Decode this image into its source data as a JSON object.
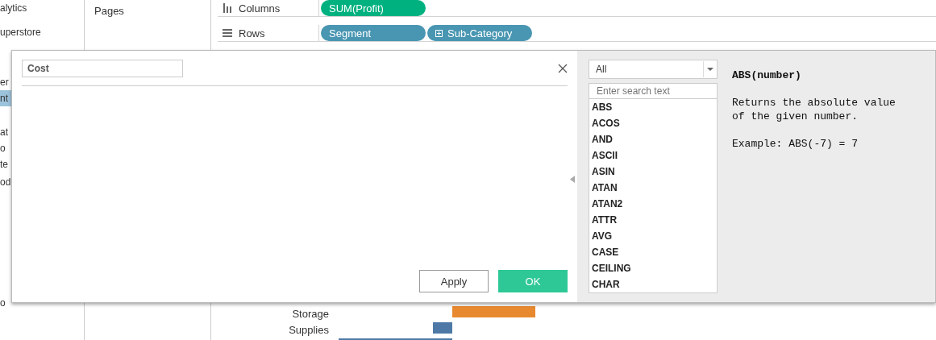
{
  "sidebar": {
    "items": [
      {
        "label": "alytics",
        "selected": false
      },
      {
        "label": "uperstore",
        "selected": false
      },
      {
        "label": "er",
        "selected": false
      },
      {
        "label": "nt",
        "selected": true
      },
      {
        "label": "at",
        "selected": false
      },
      {
        "label": "o",
        "selected": false
      },
      {
        "label": "te",
        "selected": false
      },
      {
        "label": "od",
        "selected": false
      }
    ],
    "footer_item": "o"
  },
  "pages": {
    "title": "Pages"
  },
  "shelves": [
    {
      "kind": "columns",
      "label": "Columns",
      "pills": [
        {
          "label": "SUM(Profit)",
          "kind": "measure",
          "expandable": false
        }
      ]
    },
    {
      "kind": "rows",
      "label": "Rows",
      "pills": [
        {
          "label": "Segment",
          "kind": "dimension",
          "expandable": false
        },
        {
          "label": "Sub-Category",
          "kind": "dimension",
          "expandable": true
        }
      ]
    }
  ],
  "chart": {
    "rows": [
      {
        "label": "Storage"
      },
      {
        "label": "Supplies"
      }
    ]
  },
  "dialog": {
    "name": "Cost",
    "buttons": [
      {
        "label": "Apply",
        "primary": false
      },
      {
        "label": "OK",
        "primary": true
      }
    ],
    "category": "All",
    "search_placeholder": "Enter search text",
    "functions": [
      "ABS",
      "ACOS",
      "AND",
      "ASCII",
      "ASIN",
      "ATAN",
      "ATAN2",
      "ATTR",
      "AVG",
      "CASE",
      "CEILING",
      "CHAR"
    ],
    "help": {
      "signature": "ABS(number)",
      "description": "Returns the absolute value of the given number.",
      "example": "Example: ABS(-7) = 7"
    }
  }
}
